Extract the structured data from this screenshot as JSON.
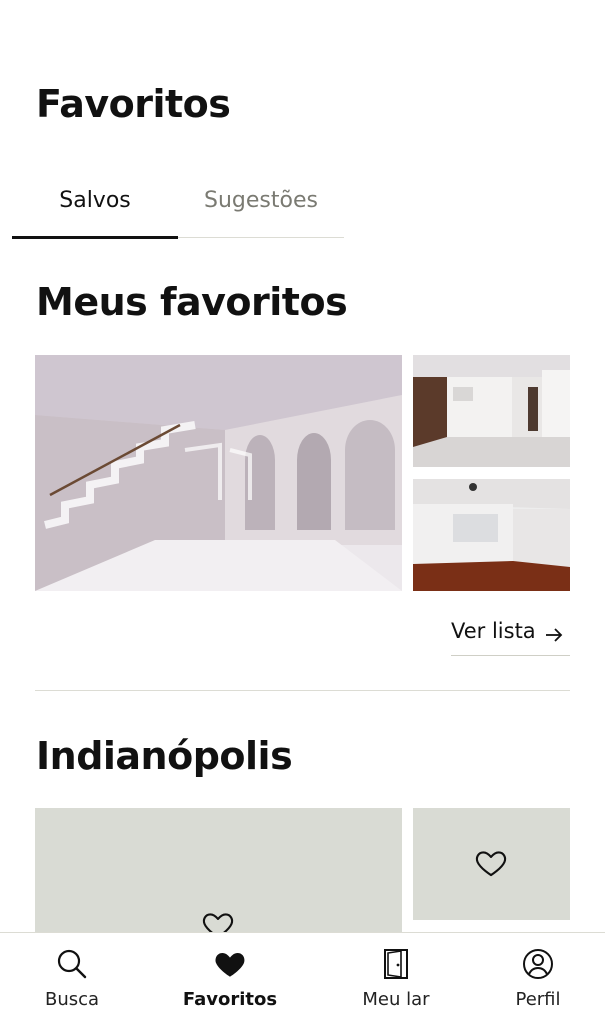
{
  "header": {
    "title": "Favoritos"
  },
  "tabs": [
    {
      "label": "Salvos",
      "active": true
    },
    {
      "label": "Sugestões",
      "active": false
    }
  ],
  "lists": [
    {
      "title": "Meus favoritos",
      "action_label": "Ver lista"
    },
    {
      "title": "Indianópolis"
    }
  ],
  "bottom_nav": [
    {
      "label": "Busca",
      "icon": "search-icon",
      "active": false
    },
    {
      "label": "Favoritos",
      "icon": "heart-icon",
      "active": true
    },
    {
      "label": "Meu lar",
      "icon": "door-icon",
      "active": false
    },
    {
      "label": "Perfil",
      "icon": "user-circle-icon",
      "active": false
    }
  ],
  "colors": {
    "text": "#111111",
    "muted": "#7a7a72",
    "placeholder": "#d9dbd4",
    "divider": "#dcdcd4"
  }
}
